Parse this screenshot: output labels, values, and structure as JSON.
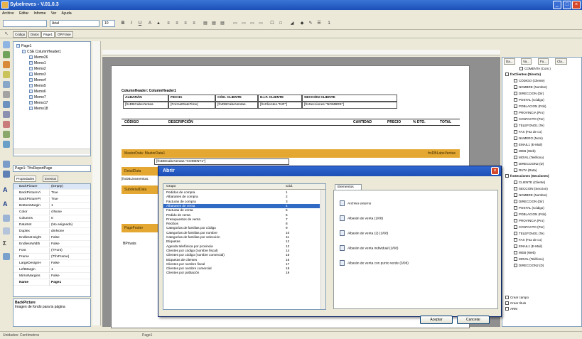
{
  "window": {
    "title": "Sybelreves - V.01.0.3"
  },
  "menu": [
    "Archivo",
    "Editar",
    "Informe",
    "Ver",
    "Ayuda"
  ],
  "toolbar": {
    "font": "Arial",
    "size": "10"
  },
  "subtoolbar": {
    "tabs": [
      "Código",
      "Datos",
      "Page1",
      "OP.Frase"
    ]
  },
  "tree": {
    "root": "Page1",
    "child": "CSE ColumnHeader1",
    "items": [
      "Memo26",
      "Memo1",
      "Memo2",
      "Memo3",
      "Memo4",
      "Memo5",
      "Memo6",
      "Memo7",
      "Memo17",
      "Memo18"
    ]
  },
  "page_combo": "Page1: TfrxReportPage",
  "prop_tabs": [
    "Propiedades",
    "Eventos"
  ],
  "properties": [
    {
      "name": "BackPicture",
      "value": "(Empty)"
    },
    {
      "name": "BackPictureVi",
      "value": "True"
    },
    {
      "name": "BackPicturePr",
      "value": "True"
    },
    {
      "name": "BottomMargin",
      "value": "1"
    },
    {
      "name": "Color",
      "value": "clNone"
    },
    {
      "name": "Columns",
      "value": "0"
    },
    {
      "name": "DataSet",
      "value": "(No asignado)"
    },
    {
      "name": "Duplex",
      "value": "dmNone"
    },
    {
      "name": "EndlessHeight",
      "value": "False"
    },
    {
      "name": "EndlessWidth",
      "value": "False"
    },
    {
      "name": "Font",
      "value": "(TFont)"
    },
    {
      "name": "Frame",
      "value": "(TfrxFrame)"
    },
    {
      "name": "LargeDesignH",
      "value": "False"
    },
    {
      "name": "LeftMargin",
      "value": "1"
    },
    {
      "name": "MirrorMargins",
      "value": "False"
    },
    {
      "name": "Name",
      "value": "Page1"
    }
  ],
  "prop_desc": {
    "title": "BackPicture",
    "text": "Imagen de fondo para la página"
  },
  "report": {
    "column_header": "ColumnHeader: ColumnHeader1",
    "header_cells": [
      "ALBARÁN",
      "FECHA",
      "CÓD. CLIENTE",
      "N.I.F. CLIENTE",
      "SECCIÓN CLIENTE"
    ],
    "value_cells": [
      "[frxDBCabeVentas.",
      "[FormatDateTime(",
      "[frxDBCabeVentas.",
      "[frxClientes.\"NIF\"]",
      "[frxSecciones.\"NOMBRE\"]"
    ],
    "detail_header": [
      "CÓDIGO",
      "DESCRIPCIÓN",
      "CANTIDAD",
      "PRECIO",
      "% DTO.",
      "TOTAL"
    ],
    "master_data": "MasterData: MasterData1",
    "master_right": "frxDBLabeVentas",
    "memo_text": "[frxDBCabeVentas.\"COMENT1\"]",
    "detail_data": "DetailData",
    "detail_row": "[frxDBLineaVentas.",
    "subdetail": "SubdetailData",
    "page_footer": "PageFooter",
    "total_label": "BPrivats"
  },
  "right_panel": {
    "tabs": [
      "Da...",
      "Va...",
      "Fu...",
      "Cla..."
    ],
    "group1": "frxClientes (Directo)",
    "group1_items": [
      "CÓDIGO (Cliente)",
      "NOMBRE (Nombre)",
      "DIRECCION (Dir)",
      "POSTAL (Código)",
      "POBLACION (Pob)",
      "PROVINCIA (Pro)",
      "CONTACTO (Per)",
      "TELEFONO1 (Te)",
      "FAX (Fax de co)",
      "NUMERO (Nom)",
      "EMAIL1 (E-Mail)",
      "WEB (Web)",
      "MOVIL (Teléfono)",
      "DIRECCION2 (D)",
      "RUTA (Ruta)"
    ],
    "top_item": "COMENTA (Com.)",
    "group2": "frxSecciones (Secciones)",
    "group2_items": [
      "CLIENTE (Cliente)",
      "SECCION (Seccion)",
      "NOMBRE (Nombre)",
      "DIRECCION (Dir)",
      "POSTAL (Código)",
      "POBLACION (Pob)",
      "PROVINCIA (Pro)",
      "CONTACTO (Per)",
      "TELEFONO1 (Te)",
      "FAX (Fax de co)",
      "EMAIL1 (E-Mail)",
      "WEB (Web)",
      "MOVIL (Teléfono)",
      "DIRECCION2 (D)"
    ],
    "checks": [
      "Crear campo",
      "Crear título",
      "ARM"
    ]
  },
  "dialog": {
    "title": "Abrir",
    "list_headers": [
      "Grupo",
      "Cód."
    ],
    "rows": [
      {
        "name": "Pedidos de compra",
        "code": "1"
      },
      {
        "name": "Albaranes de compra",
        "code": "2"
      },
      {
        "name": "Facturas de compra",
        "code": "3"
      },
      {
        "name": "Albaranes de venta",
        "code": "4"
      },
      {
        "name": "Facturas de venta",
        "code": "5"
      },
      {
        "name": "Pedido de venta",
        "code": "6"
      },
      {
        "name": "Presupuestos de venta",
        "code": "7"
      },
      {
        "name": "Recibos",
        "code": "8"
      },
      {
        "name": "Categorías de familias por código",
        "code": "9"
      },
      {
        "name": "Categorías de familias por nombre",
        "code": "10"
      },
      {
        "name": "Categorías de familias por selección",
        "code": "11"
      },
      {
        "name": "Etiquetas",
        "code": "12"
      },
      {
        "name": "Agenda telefónica por provincia",
        "code": "13"
      },
      {
        "name": "Clientes por código (nombre fiscal)",
        "code": "14"
      },
      {
        "name": "Clientes por código (nombre comercial)",
        "code": "15"
      },
      {
        "name": "Etiquetas de clientes",
        "code": "16"
      },
      {
        "name": "Clientes por nombre fiscal",
        "code": "17"
      },
      {
        "name": "Clientes por nombre comercial",
        "code": "18"
      },
      {
        "name": "Clientes por población",
        "code": "19"
      }
    ],
    "selected_index": 3,
    "tab": "Elementos",
    "elements": [
      "Archivo externo",
      "Albarán de venta (1/08)",
      "Albarán de venta (2) (1/08)",
      "Albarán de venta individual (2/08)",
      "Albarán de venta con punto verde (3/08)"
    ],
    "ok": "Aceptar",
    "cancel": "Cancelar"
  },
  "status": {
    "left": "Unidades: Centímetros",
    "right": "Page1"
  }
}
